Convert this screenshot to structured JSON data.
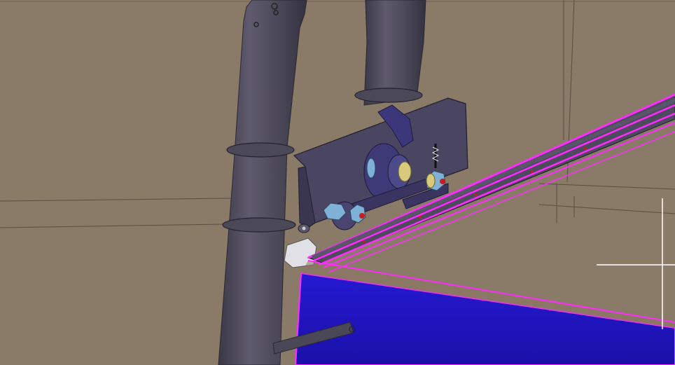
{
  "viewport": {
    "kind": "cad-3d-view",
    "background_color": "#8a7a68",
    "highlight_color": "#ff2bff",
    "selected_face_color": "#1f14c8",
    "tube_color": "#4d4a5a",
    "bracket_color": "#4a4560",
    "nut_color": "#7fb0d6",
    "washer_color": "#d9c97a"
  }
}
